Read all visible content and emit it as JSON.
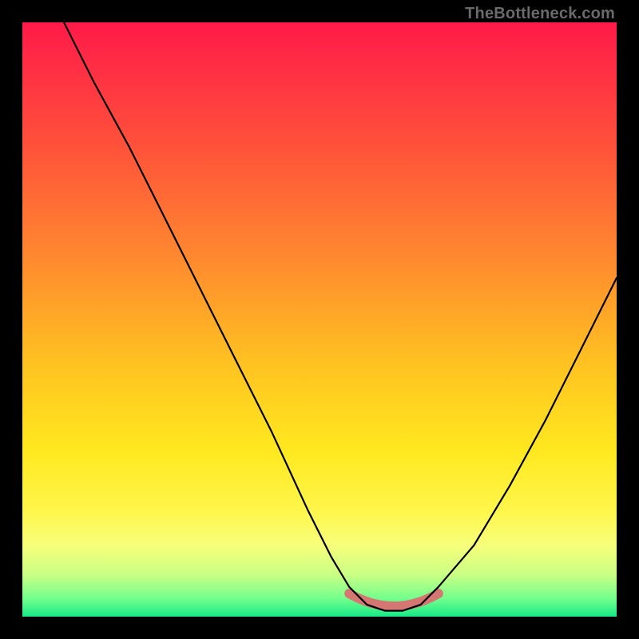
{
  "watermark": "TheBottleneck.com",
  "chart_data": {
    "type": "line",
    "title": "",
    "xlabel": "",
    "ylabel": "",
    "xlim": [
      0,
      100
    ],
    "ylim": [
      0,
      100
    ],
    "grid": false,
    "legend": false,
    "series": [
      {
        "name": "bottleneck-curve",
        "x": [
          7,
          12,
          18,
          24,
          30,
          36,
          42,
          48,
          52,
          55,
          58,
          61,
          64,
          67,
          70,
          76,
          82,
          88,
          94,
          100
        ],
        "values": [
          100,
          90,
          79,
          67,
          55,
          43,
          31,
          18,
          10,
          5,
          2,
          1,
          1,
          2,
          5,
          12,
          22,
          33,
          45,
          57
        ]
      }
    ],
    "highlight": {
      "name": "min-band",
      "x_range": [
        55,
        70
      ],
      "y_level": 2,
      "color": "#d67672"
    },
    "background_gradient": {
      "stops": [
        {
          "pos": 0.0,
          "color": "#ff1a49"
        },
        {
          "pos": 0.2,
          "color": "#ff4f3b"
        },
        {
          "pos": 0.4,
          "color": "#ff8a2e"
        },
        {
          "pos": 0.58,
          "color": "#ffc421"
        },
        {
          "pos": 0.72,
          "color": "#ffe81f"
        },
        {
          "pos": 0.82,
          "color": "#fff64a"
        },
        {
          "pos": 0.88,
          "color": "#f7ff7a"
        },
        {
          "pos": 0.93,
          "color": "#c9ff85"
        },
        {
          "pos": 0.97,
          "color": "#72ff8c"
        },
        {
          "pos": 1.0,
          "color": "#17e887"
        }
      ]
    }
  }
}
